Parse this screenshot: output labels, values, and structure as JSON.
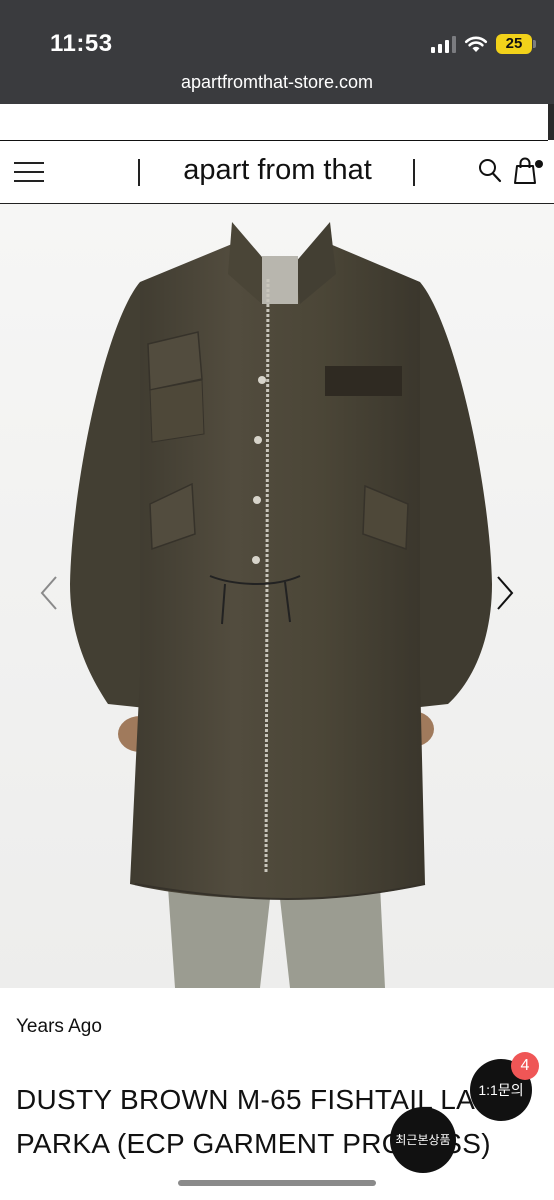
{
  "status_bar": {
    "time": "11:53",
    "battery": "25",
    "url": "apartfromthat-store.com"
  },
  "header": {
    "logo": "apart from that"
  },
  "icons": {
    "menu": "menu-icon",
    "search": "search-icon",
    "cart": "shopping-bag-icon",
    "prev": "chevron-left-icon",
    "next": "chevron-right-icon"
  },
  "product": {
    "brand": "Years Ago",
    "title": "DUSTY BROWN M-65 FISHTAIL LAND PARKA (ECP GARMENT PROCESS)"
  },
  "floating": {
    "chat_label": "1:1문의",
    "chat_badge": "4",
    "recent_label": "최근본상품"
  },
  "colors": {
    "status_bg": "#3a3b3e",
    "battery": "#f2d21a",
    "badge": "#ef5656",
    "parka": "#4a4537"
  }
}
